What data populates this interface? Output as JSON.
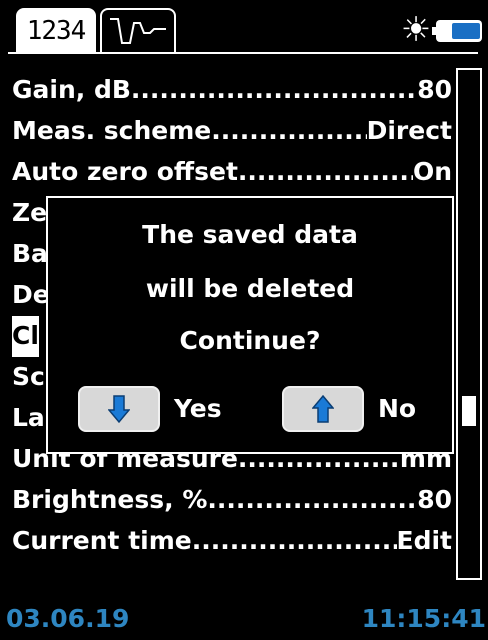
{
  "tabs": {
    "digital_label": "1234",
    "waveform_icon": "waveform-icon"
  },
  "header_icons": {
    "brightness": "sun-icon",
    "battery": "battery-icon"
  },
  "rows": [
    {
      "label": "Gain, dB",
      "value": "80"
    },
    {
      "label": "Meas. scheme",
      "value": "Direct"
    },
    {
      "label": "Auto zero offset",
      "value": "On"
    },
    {
      "label": "Ze",
      "value": ""
    },
    {
      "label": "Ba",
      "value": ""
    },
    {
      "label": "De",
      "value": ""
    },
    {
      "label": "Cl",
      "value": ""
    },
    {
      "label": "Sc",
      "value": ""
    },
    {
      "label": "La",
      "value": ""
    },
    {
      "label": "Unit of measure",
      "value": " mm"
    },
    {
      "label": "Brightness, %",
      "value": "80"
    },
    {
      "label": "Current time",
      "value": "Edit"
    }
  ],
  "dialog": {
    "line1": "The saved data",
    "line2": "will be deleted",
    "line3": "Continue?",
    "yes_label": "Yes",
    "no_label": "No",
    "yes_icon": "arrow-down-icon",
    "no_icon": "arrow-up-icon"
  },
  "status": {
    "date": "03.06.19",
    "time": "11:15:41"
  },
  "colors": {
    "background": "#000000",
    "foreground": "#ffffff",
    "accent_blue": "#2e86c1",
    "button_face": "#d8d8d8",
    "arrow_blue": "#1a7ad6"
  },
  "scroll": {
    "position_fraction": 0.68
  }
}
